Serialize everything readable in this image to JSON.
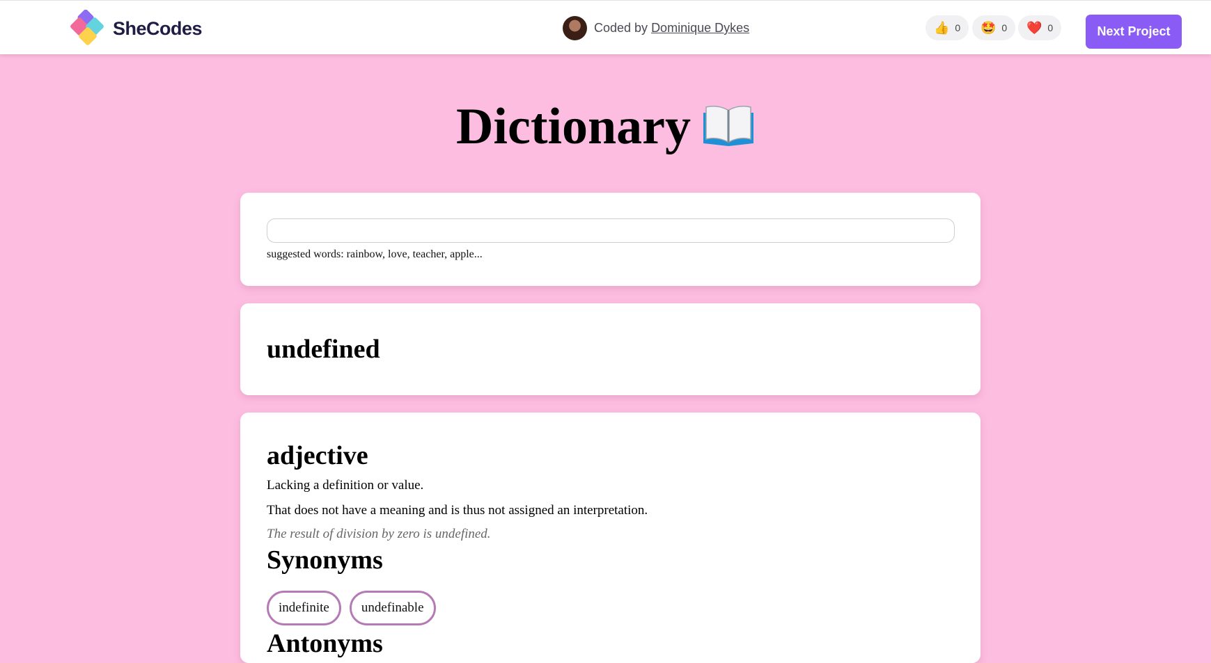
{
  "header": {
    "logo_text": "SheCodes",
    "coded_by_prefix": "Coded by",
    "author_name": "Dominique Dykes",
    "reactions": [
      {
        "icon": "thumbs-up-icon",
        "emoji": "👍",
        "count": "0"
      },
      {
        "icon": "star-struck-icon",
        "emoji": "🤩",
        "count": "0"
      },
      {
        "icon": "heart-icon",
        "emoji": "❤️",
        "count": "0"
      }
    ],
    "next_button": "Next Project",
    "accent_color": "#8a5cf5"
  },
  "page": {
    "title": "Dictionary",
    "background_color": "#fdbde0"
  },
  "search": {
    "value": "",
    "placeholder": "",
    "hint": "suggested words: rainbow, love, teacher, apple..."
  },
  "result": {
    "word": "undefined",
    "meaning": {
      "part_of_speech": "adjective",
      "definitions": [
        "Lacking a definition or value.",
        "That does not have a meaning and is thus not assigned an interpretation."
      ],
      "example": "The result of division by zero is undefined.",
      "synonyms_heading": "Synonyms",
      "synonyms": [
        "indefinite",
        "undefinable"
      ],
      "antonyms_heading": "Antonyms"
    }
  }
}
